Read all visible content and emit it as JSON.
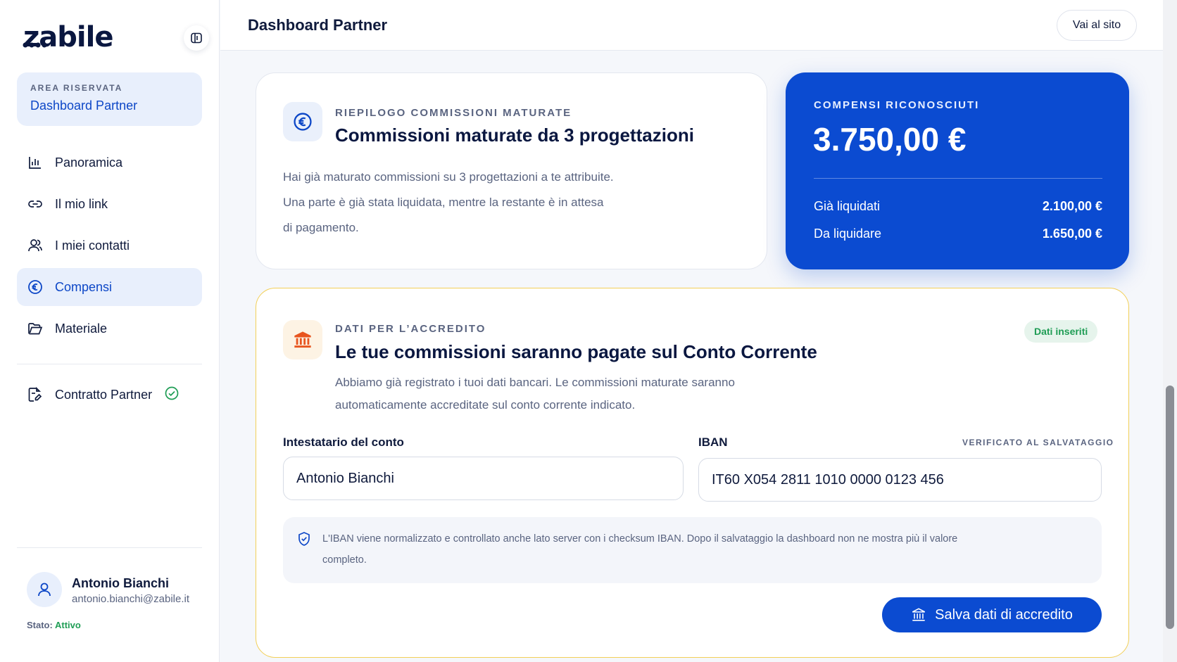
{
  "brand": {
    "name": "zabile"
  },
  "sidebar": {
    "area_label": "AREA RISERVATA",
    "area_title": "Dashboard Partner",
    "items": [
      {
        "label": "Panoramica",
        "icon": "bar-chart-icon"
      },
      {
        "label": "Il mio link",
        "icon": "link-icon"
      },
      {
        "label": "I miei contatti",
        "icon": "users-icon"
      },
      {
        "label": "Compensi",
        "icon": "euro-icon",
        "active": true
      },
      {
        "label": "Materiale",
        "icon": "folder-icon"
      }
    ],
    "contract": {
      "label": "Contratto Partner",
      "icon": "document-edit-icon",
      "status_icon": "check-circle-icon"
    },
    "user": {
      "name": "Antonio Bianchi",
      "email": "antonio.bianchi@zabile.it",
      "state_label": "Stato:",
      "state_value": "Attivo"
    }
  },
  "header": {
    "title": "Dashboard Partner",
    "site_button": "Vai al sito"
  },
  "summary": {
    "eyebrow": "RIEPILOGO COMMISSIONI MATURATE",
    "title": "Commissioni maturate da 3 progettazioni",
    "description_lines": [
      "Hai già maturato commissioni su 3 progettazioni a te attribuite.",
      "Una parte è già stata liquidata, mentre la restante è in attesa",
      "di pagamento."
    ]
  },
  "compensation": {
    "eyebrow": "COMPENSI RICONOSCIUTI",
    "total": "3.750,00 €",
    "paid_label": "Già liquidati",
    "paid_value": "2.100,00 €",
    "due_label": "Da liquidare",
    "due_value": "1.650,00 €"
  },
  "credit": {
    "eyebrow": "DATI PER L’ACCREDITO",
    "title": "Le tue commissioni saranno pagate sul Conto Corrente",
    "badge": "Dati inseriti",
    "description_lines": [
      "Abbiamo già registrato i tuoi dati bancari. Le commissioni maturate saranno",
      "automaticamente accreditate sul conto corrente indicato."
    ],
    "holder_label": "Intestatario del conto",
    "holder_value": "Antonio Bianchi",
    "iban_label": "IBAN",
    "iban_hint": "VERIFICATO AL SALVATAGGIO",
    "iban_value": "IT60 X054 2811 1010 0000 0123 456",
    "note_lines": [
      "L'IBAN viene normalizzato e controllato anche lato server con i checksum IBAN. Dopo il salvataggio la dashboard non ne mostra più il valore",
      "completo."
    ],
    "save_button": "Salva dati di accredito"
  },
  "colors": {
    "accent": "#0b4bd1",
    "success": "#1f9d55",
    "warning_border": "#f2cf57"
  }
}
